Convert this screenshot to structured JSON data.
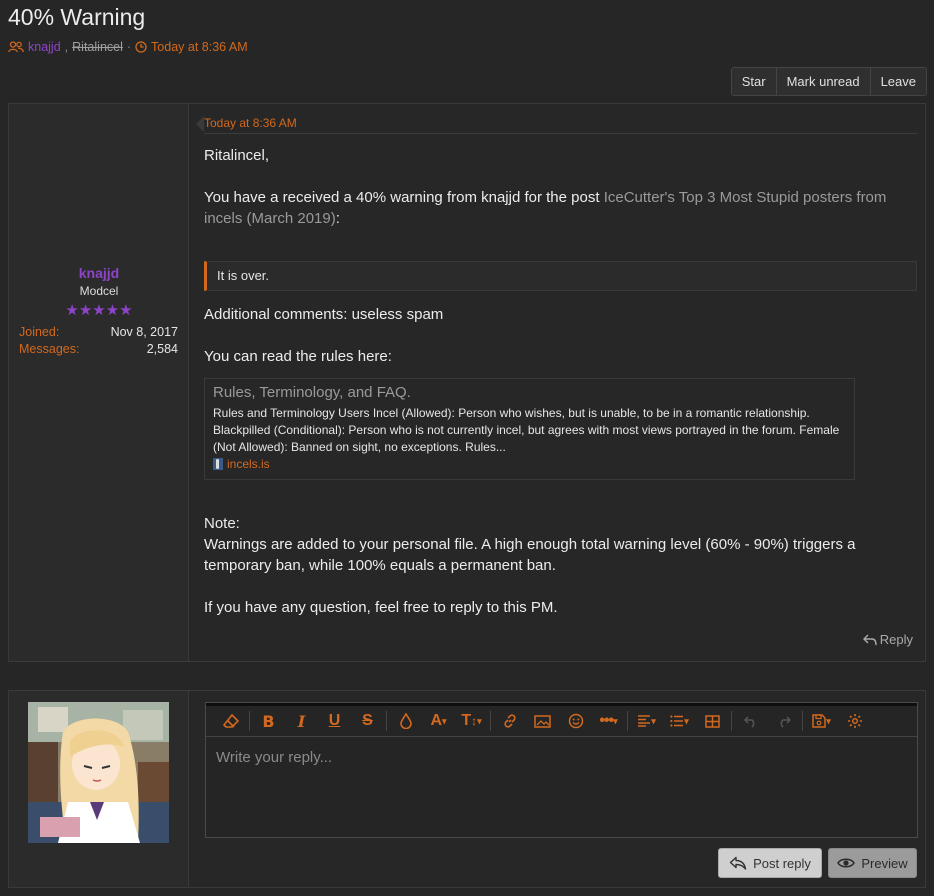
{
  "thread": {
    "title": "40% Warning",
    "participant_1": "knajjd",
    "participant_2": "Ritalincel",
    "comma": ",",
    "separator": "·",
    "time": "Today at 8:36 AM"
  },
  "actions": {
    "star": "Star",
    "mark_unread": "Mark unread",
    "leave": "Leave"
  },
  "author": {
    "name": "knajjd",
    "title": "Modcel",
    "stars": "★★★★★",
    "joined_label": "Joined:",
    "joined_value": "Nov 8, 2017",
    "messages_label": "Messages:",
    "messages_value": "2,584"
  },
  "message": {
    "time": "Today at 8:36 AM",
    "greeting": "Ritalincel,",
    "warning_prefix": "You have a received a 40% warning from knajjd for the post ",
    "warning_link": "IceCutter's Top 3 Most Stupid posters from incels (March 2019)",
    "warning_suffix": ":",
    "quote": "It is over.",
    "comments": "Additional comments: useless spam",
    "rules_intro": "You can read the rules here:",
    "unfurl_title": "Rules, Terminology, and FAQ.",
    "unfurl_desc": "Rules and Terminology Users Incel (Allowed): Person who wishes, but is unable, to be in a romantic relationship. Blackpilled (Conditional): Person who is not currently incel, but agrees with most views portrayed in the forum. Female (Not Allowed): Banned on sight, no exceptions. Rules...",
    "unfurl_site": "incels.is",
    "note_label": "Note:",
    "note_text": "Warnings are added to your personal file. A high enough total warning level (60% - 90%) triggers a temporary ban, while 100% equals a permanent ban.",
    "closing": "If you have any question, feel free to reply to this PM.",
    "reply_link": "Reply"
  },
  "editor": {
    "placeholder": "Write your reply...",
    "post_reply": "Post reply",
    "preview": "Preview"
  },
  "colors": {
    "accent": "#d2691e",
    "user": "#8e44c9",
    "background": "#262626"
  }
}
